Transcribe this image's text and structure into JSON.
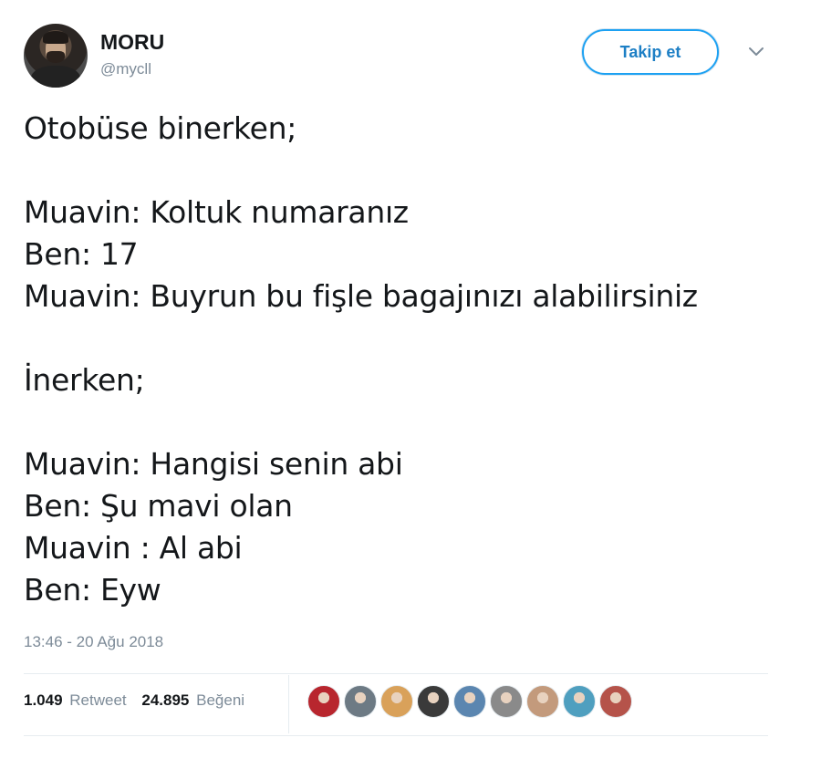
{
  "user": {
    "display_name": "MORU",
    "handle": "@mycll"
  },
  "follow_button": {
    "label": "Takip et"
  },
  "tweet": {
    "lines": [
      "Otobüse binerken;",
      "",
      "Muavin: Koltuk numaranız",
      "Ben: 17",
      "Muavin: Buyrun bu fişle bagajınızı alabilirsiniz",
      "",
      "İnerken;",
      "",
      "Muavin: Hangisi senin abi",
      "Ben: Şu mavi olan",
      "Muavin : Al abi",
      "Ben: Eyw"
    ],
    "timestamp": "13:46 - 20 Ağu 2018"
  },
  "stats": {
    "retweets": {
      "count": "1.049",
      "label": "Retweet"
    },
    "likes": {
      "count": "24.895",
      "label": "Beğeni"
    }
  },
  "liker_avatars": [
    {
      "icon": "avatar-icon",
      "color": "#b8262e"
    },
    {
      "icon": "avatar-icon",
      "color": "#6d7a84"
    },
    {
      "icon": "avatar-icon",
      "color": "#d9a15a"
    },
    {
      "icon": "avatar-icon",
      "color": "#3a3a3a"
    },
    {
      "icon": "avatar-icon",
      "color": "#5b86b0"
    },
    {
      "icon": "avatar-icon",
      "color": "#8a8a8a"
    },
    {
      "icon": "avatar-icon",
      "color": "#c39a7c"
    },
    {
      "icon": "avatar-icon",
      "color": "#4f9fbf"
    },
    {
      "icon": "avatar-icon",
      "color": "#b5534a"
    }
  ],
  "colors": {
    "accent": "#1da1f2",
    "muted_text": "#7d8b98",
    "divider": "#e6ecf0"
  }
}
